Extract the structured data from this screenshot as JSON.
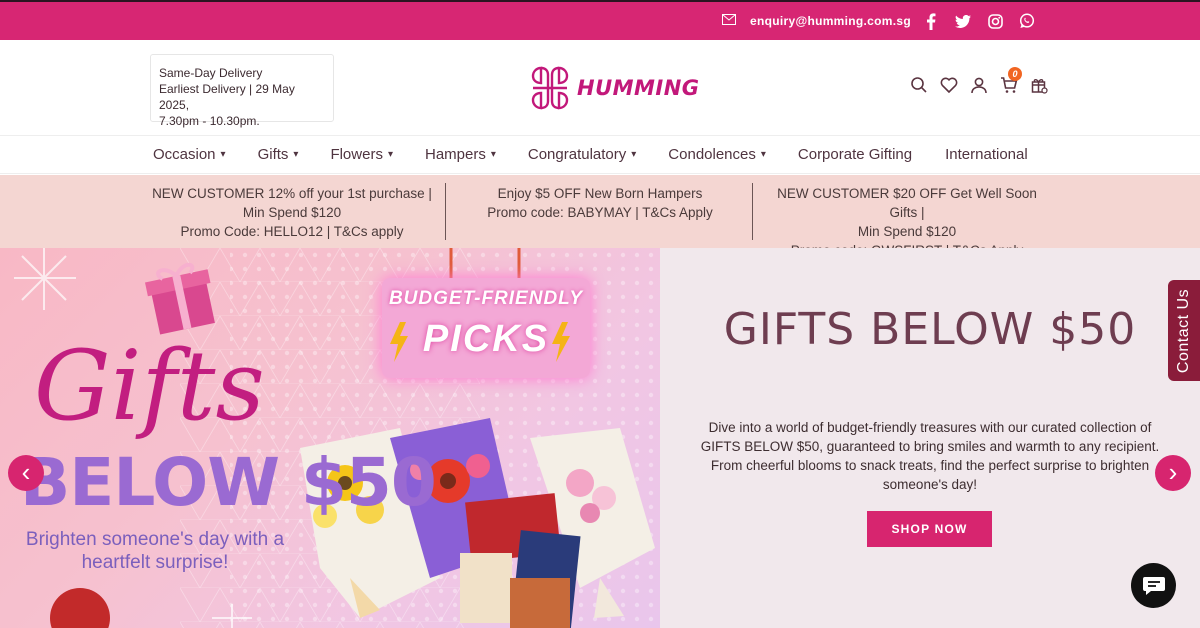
{
  "topbar": {
    "email": "enquiry@humming.com.sg",
    "social": [
      "facebook-icon",
      "twitter-icon",
      "instagram-icon",
      "whatsapp-icon"
    ],
    "bg_color": "#d72673"
  },
  "header": {
    "delivery_line1": "Same-Day Delivery",
    "delivery_line2": "Earliest Delivery | 29 May 2025,",
    "delivery_line3": "7.30pm - 10.30pm.",
    "logo_text": "HUMMING",
    "cart_count": "0",
    "icons": [
      "search-icon",
      "wishlist-icon",
      "account-icon",
      "cart-icon",
      "gift-tracker-icon"
    ]
  },
  "nav": {
    "items": [
      {
        "label": "Occasion",
        "dropdown": "true"
      },
      {
        "label": "Gifts",
        "dropdown": "true"
      },
      {
        "label": "Flowers",
        "dropdown": "true"
      },
      {
        "label": "Hampers",
        "dropdown": "true"
      },
      {
        "label": "Congratulatory",
        "dropdown": "true"
      },
      {
        "label": "Condolences",
        "dropdown": "true"
      },
      {
        "label": "Corporate Gifting",
        "dropdown": ""
      },
      {
        "label": "International",
        "dropdown": ""
      }
    ],
    "chevron": "▾"
  },
  "promos": [
    {
      "l1": "NEW CUSTOMER 12% off your 1st purchase |",
      "l2": "Min Spend $120",
      "l3": "Promo Code: HELLO12 | T&Cs apply"
    },
    {
      "l1": "Enjoy $5 OFF New Born Hampers",
      "l2": "Promo code: BABYMAY | T&Cs Apply",
      "l3": ""
    },
    {
      "l1": "NEW CUSTOMER $20 OFF Get Well Soon Gifts |",
      "l2": "Min Spend $120",
      "l3": "Promo code: GWSFIRST | T&Cs Apply"
    }
  ],
  "hero": {
    "sign_top": "BUDGET-FRIENDLY",
    "sign_bottom": "PICKS",
    "banner_script": "Gifts",
    "banner_below": "BELOW $50",
    "banner_tagline_1": "Brighten someone's day with a",
    "banner_tagline_2": "heartfelt surprise!",
    "title": "GIFTS BELOW $50",
    "description": "Dive into a world of budget-friendly treasures with our curated collection of GIFTS BELOW $50, guaranteed to bring smiles and warmth to any recipient. From cheerful blooms to snack treats, find the perfect surprise to brighten someone's day!",
    "cta": "SHOP NOW",
    "prev_arrow": "‹",
    "next_arrow": "›",
    "accent": "#d7256f"
  },
  "contact_tab": "Contact Us"
}
